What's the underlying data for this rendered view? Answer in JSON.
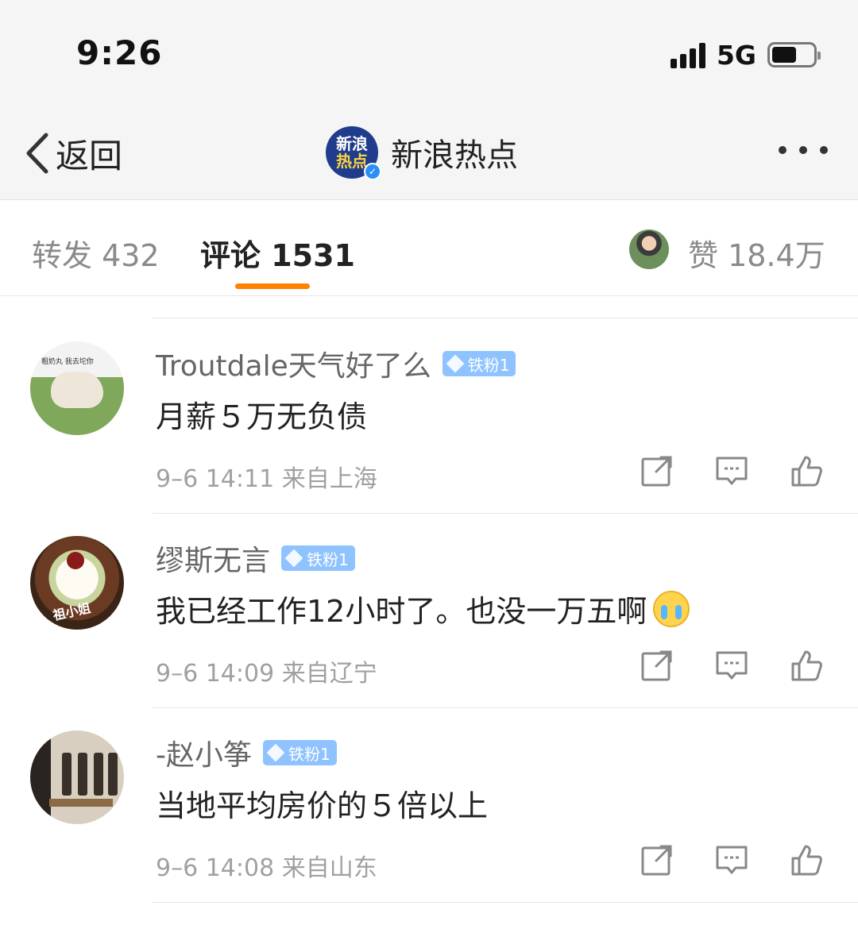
{
  "status_bar": {
    "time": "9:26",
    "network": "5G"
  },
  "nav": {
    "back_label": "返回",
    "logo_line1": "新浪",
    "logo_line2": "热点",
    "title": "新浪热点"
  },
  "tabs": {
    "repost": "转发 432",
    "comments": "评论 1531",
    "likes": "赞 18.4万"
  },
  "colors": {
    "accent": "#ff8200",
    "badge": "#8fc3ff",
    "verified": "#2b8ff7"
  },
  "comments": [
    {
      "username": "Troutdale天气好了么",
      "badge": "铁粉1",
      "avatar_caption": "粗奶丸  我去坨你",
      "text": "月薪５万无负债",
      "meta": "9–6 14:11  来自上海",
      "has_emoji": false
    },
    {
      "username": "缪斯无言",
      "badge": "铁粉1",
      "avatar_caption": "祖小姐",
      "text": "我已经工作12小时了。也没一万五啊",
      "meta": "9–6 14:09  来自辽宁",
      "has_emoji": true,
      "emoji": "crying-face"
    },
    {
      "username": "-赵小筝",
      "badge": "铁粉1",
      "avatar_caption": "",
      "text": "当地平均房价的５倍以上",
      "meta": "9–6 14:08  来自山东",
      "has_emoji": false
    }
  ]
}
